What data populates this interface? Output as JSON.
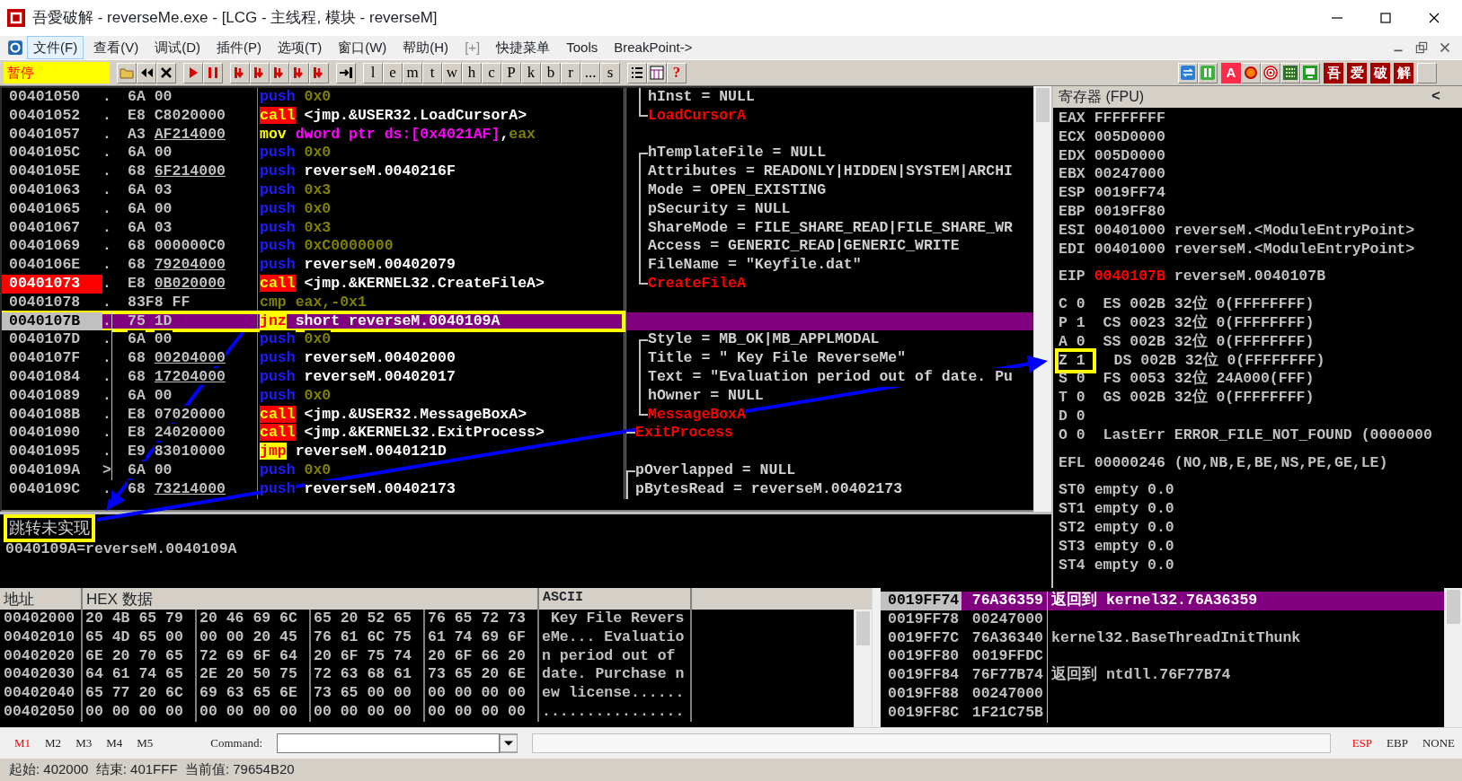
{
  "window": {
    "title": "吾愛破解 - reverseMe.exe - [LCG - 主线程, 模块 - reverseM]"
  },
  "menu": [
    {
      "label": "文件(F)",
      "selected": true,
      "disabled": false
    },
    {
      "label": "查看(V)",
      "selected": false,
      "disabled": false
    },
    {
      "label": "调试(D)",
      "selected": false,
      "disabled": false
    },
    {
      "label": "插件(P)",
      "selected": false,
      "disabled": false
    },
    {
      "label": "选项(T)",
      "selected": false,
      "disabled": false
    },
    {
      "label": "窗口(W)",
      "selected": false,
      "disabled": false
    },
    {
      "label": "帮助(H)",
      "selected": false,
      "disabled": false
    },
    {
      "label": "[+]",
      "selected": false,
      "disabled": true
    },
    {
      "label": "快捷菜单",
      "selected": false,
      "disabled": false
    },
    {
      "label": "Tools",
      "selected": false,
      "disabled": false
    },
    {
      "label": "BreakPoint->",
      "selected": false,
      "disabled": false
    }
  ],
  "toolbar": {
    "status": "暂停",
    "letters": [
      "l",
      "e",
      "m",
      "t",
      "w",
      "h",
      "c",
      "P",
      "k",
      "b",
      "r",
      "...",
      "s"
    ],
    "help": "?",
    "plugins": [
      "A",
      "吾",
      "爱",
      "破",
      "解"
    ]
  },
  "disassembly": {
    "rows": [
      {
        "address": "00401050",
        "mark": ".",
        "opcode": "6A",
        "arg": "00",
        "ref": false,
        "mnemonic": "push",
        "kind": "push",
        "operand": [
          {
            "text": "0x0",
            "kind": "const"
          }
        ],
        "breakpoint": false,
        "current": false,
        "boxed": false,
        "in_jump": false,
        "comment": {
          "text": "hInst = NULL",
          "kind": "arg",
          "bracket_start": false,
          "bracket_end": false,
          "outer": false
        }
      },
      {
        "address": "00401052",
        "mark": ".",
        "opcode": "E8",
        "arg": "C8020000",
        "ref": false,
        "mnemonic": "call",
        "kind": "call",
        "operand": [
          {
            "text": "<jmp.&USER32.LoadCursorA>",
            "kind": "plain"
          }
        ],
        "breakpoint": false,
        "current": false,
        "boxed": false,
        "in_jump": false,
        "comment": {
          "text": "LoadCursorA",
          "kind": "api",
          "bracket_start": false,
          "bracket_end": true,
          "outer": false
        }
      },
      {
        "address": "00401057",
        "mark": ".",
        "opcode": "A3",
        "arg": "AF214000",
        "ref": true,
        "mnemonic": "mov",
        "kind": "mov",
        "operand": [
          {
            "text": "dword ptr ds:[0x4021AF]",
            "kind": "mem"
          },
          {
            "text": ",",
            "kind": "plain"
          },
          {
            "text": "eax",
            "kind": "const"
          }
        ],
        "breakpoint": false,
        "current": false,
        "boxed": false,
        "in_jump": false
      },
      {
        "address": "0040105C",
        "mark": ".",
        "opcode": "6A",
        "arg": "00",
        "ref": false,
        "mnemonic": "push",
        "kind": "push",
        "operand": [
          {
            "text": "0x0",
            "kind": "const"
          }
        ],
        "breakpoint": false,
        "current": false,
        "boxed": false,
        "in_jump": false,
        "comment": {
          "text": "hTemplateFile = NULL",
          "kind": "arg",
          "bracket_start": true,
          "bracket_end": false,
          "outer": false
        }
      },
      {
        "address": "0040105E",
        "mark": ".",
        "opcode": "68",
        "arg": "6F214000",
        "ref": true,
        "mnemonic": "push",
        "kind": "push",
        "operand": [
          {
            "text": "reverseM.0040216F",
            "kind": "plain"
          }
        ],
        "breakpoint": false,
        "current": false,
        "boxed": false,
        "in_jump": false,
        "comment": {
          "text": "Attributes = READONLY|HIDDEN|SYSTEM|ARCHI",
          "kind": "arg",
          "bracket_start": false,
          "bracket_end": false,
          "outer": false
        }
      },
      {
        "address": "00401063",
        "mark": ".",
        "opcode": "6A",
        "arg": "03",
        "ref": false,
        "mnemonic": "push",
        "kind": "push",
        "operand": [
          {
            "text": "0x3",
            "kind": "const"
          }
        ],
        "breakpoint": false,
        "current": false,
        "boxed": false,
        "in_jump": false,
        "comment": {
          "text": "Mode = OPEN_EXISTING",
          "kind": "arg",
          "bracket_start": false,
          "bracket_end": false,
          "outer": false
        }
      },
      {
        "address": "00401065",
        "mark": ".",
        "opcode": "6A",
        "arg": "00",
        "ref": false,
        "mnemonic": "push",
        "kind": "push",
        "operand": [
          {
            "text": "0x0",
            "kind": "const"
          }
        ],
        "breakpoint": false,
        "current": false,
        "boxed": false,
        "in_jump": false,
        "comment": {
          "text": "pSecurity = NULL",
          "kind": "arg",
          "bracket_start": false,
          "bracket_end": false,
          "outer": false
        }
      },
      {
        "address": "00401067",
        "mark": ".",
        "opcode": "6A",
        "arg": "03",
        "ref": false,
        "mnemonic": "push",
        "kind": "push",
        "operand": [
          {
            "text": "0x3",
            "kind": "const"
          }
        ],
        "breakpoint": false,
        "current": false,
        "boxed": false,
        "in_jump": false,
        "comment": {
          "text": "ShareMode = FILE_SHARE_READ|FILE_SHARE_WR",
          "kind": "arg",
          "bracket_start": false,
          "bracket_end": false,
          "outer": false
        }
      },
      {
        "address": "00401069",
        "mark": ".",
        "opcode": "68",
        "arg": "000000C0",
        "ref": false,
        "mnemonic": "push",
        "kind": "push",
        "operand": [
          {
            "text": "0xC0000000",
            "kind": "const"
          }
        ],
        "breakpoint": false,
        "current": false,
        "boxed": false,
        "in_jump": false,
        "comment": {
          "text": "Access = GENERIC_READ|GENERIC_WRITE",
          "kind": "arg",
          "bracket_start": false,
          "bracket_end": false,
          "outer": false
        }
      },
      {
        "address": "0040106E",
        "mark": ".",
        "opcode": "68",
        "arg": "79204000",
        "ref": true,
        "mnemonic": "push",
        "kind": "push",
        "operand": [
          {
            "text": "reverseM.00402079",
            "kind": "plain"
          }
        ],
        "breakpoint": false,
        "current": false,
        "boxed": false,
        "in_jump": false,
        "comment": {
          "text": "FileName = \"Keyfile.dat\"",
          "kind": "arg",
          "bracket_start": false,
          "bracket_end": false,
          "outer": false
        }
      },
      {
        "address": "00401073",
        "mark": ".",
        "opcode": "E8",
        "arg": "0B020000",
        "ref": true,
        "mnemonic": "call",
        "kind": "call",
        "operand": [
          {
            "text": "<jmp.&KERNEL32.CreateFileA>",
            "kind": "plain"
          }
        ],
        "breakpoint": true,
        "current": false,
        "boxed": false,
        "in_jump": false,
        "comment": {
          "text": "CreateFileA",
          "kind": "api",
          "bracket_start": false,
          "bracket_end": true,
          "outer": false
        }
      },
      {
        "address": "00401078",
        "mark": ".",
        "opcode": "83F8",
        "arg": "FF",
        "ref": false,
        "mnemonic": "cmp",
        "kind": "cmp",
        "operand": [
          {
            "text": "eax,-0x1",
            "kind": "const"
          }
        ],
        "breakpoint": false,
        "current": false,
        "boxed": false,
        "in_jump": false
      },
      {
        "address": "0040107B",
        "mark": ".",
        "opcode": "75",
        "arg": "1D",
        "ref": false,
        "mnemonic": "jnz",
        "kind": "jcc",
        "operand": [
          {
            "text": "short reverseM.0040109A",
            "kind": "plain"
          }
        ],
        "breakpoint": false,
        "current": true,
        "boxed": true,
        "in_jump": true
      },
      {
        "address": "0040107D",
        "mark": ".",
        "opcode": "6A",
        "arg": "00",
        "ref": false,
        "mnemonic": "push",
        "kind": "push",
        "operand": [
          {
            "text": "0x0",
            "kind": "const"
          }
        ],
        "breakpoint": false,
        "current": false,
        "boxed": false,
        "in_jump": true,
        "comment": {
          "text": "Style = MB_OK|MB_APPLMODAL",
          "kind": "arg",
          "bracket_start": true,
          "bracket_end": false,
          "outer": false
        }
      },
      {
        "address": "0040107F",
        "mark": ".",
        "opcode": "68",
        "arg": "00204000",
        "ref": true,
        "mnemonic": "push",
        "kind": "push",
        "operand": [
          {
            "text": "reverseM.00402000",
            "kind": "plain"
          }
        ],
        "breakpoint": false,
        "current": false,
        "boxed": false,
        "in_jump": true,
        "comment": {
          "text": "Title = \" Key File ReverseMe\"",
          "kind": "arg",
          "bracket_start": false,
          "bracket_end": false,
          "outer": false
        }
      },
      {
        "address": "00401084",
        "mark": ".",
        "opcode": "68",
        "arg": "17204000",
        "ref": true,
        "mnemonic": "push",
        "kind": "push",
        "operand": [
          {
            "text": "reverseM.00402017",
            "kind": "plain"
          }
        ],
        "breakpoint": false,
        "current": false,
        "boxed": false,
        "in_jump": true,
        "comment": {
          "text": "Text = \"Evaluation period out of date. Pu",
          "kind": "arg",
          "bracket_start": false,
          "bracket_end": false,
          "outer": false
        }
      },
      {
        "address": "00401089",
        "mark": ".",
        "opcode": "6A",
        "arg": "00",
        "ref": false,
        "mnemonic": "push",
        "kind": "push",
        "operand": [
          {
            "text": "0x0",
            "kind": "const"
          }
        ],
        "breakpoint": false,
        "current": false,
        "boxed": false,
        "in_jump": true,
        "comment": {
          "text": "hOwner = NULL",
          "kind": "arg",
          "bracket_start": false,
          "bracket_end": false,
          "outer": false
        }
      },
      {
        "address": "0040108B",
        "mark": ".",
        "opcode": "E8",
        "arg": "07020000",
        "ref": false,
        "mnemonic": "call",
        "kind": "call",
        "operand": [
          {
            "text": "<jmp.&USER32.MessageBoxA>",
            "kind": "plain"
          }
        ],
        "breakpoint": false,
        "current": false,
        "boxed": false,
        "in_jump": true,
        "comment": {
          "text": "MessageBoxA",
          "kind": "api",
          "bracket_start": false,
          "bracket_end": true,
          "outer": false
        }
      },
      {
        "address": "00401090",
        "mark": ".",
        "opcode": "E8",
        "arg": "24020000",
        "ref": false,
        "mnemonic": "call",
        "kind": "call",
        "operand": [
          {
            "text": "<jmp.&KERNEL32.ExitProcess>",
            "kind": "plain"
          }
        ],
        "breakpoint": false,
        "current": false,
        "boxed": false,
        "in_jump": true,
        "comment": {
          "text": "ExitProcess",
          "kind": "api",
          "bracket_start": true,
          "bracket_end": true,
          "outer": true
        }
      },
      {
        "address": "00401095",
        "mark": ".",
        "opcode": "E9",
        "arg": "83010000",
        "ref": false,
        "mnemonic": "jmp",
        "kind": "jmp",
        "operand": [
          {
            "text": "reverseM.0040121D",
            "kind": "plain"
          }
        ],
        "breakpoint": false,
        "current": false,
        "boxed": false,
        "in_jump": true
      },
      {
        "address": "0040109A",
        "mark": ">",
        "opcode": "6A",
        "arg": "00",
        "ref": false,
        "mnemonic": "push",
        "kind": "push",
        "operand": [
          {
            "text": "0x0",
            "kind": "const"
          }
        ],
        "breakpoint": false,
        "current": false,
        "boxed": false,
        "in_jump": true,
        "comment": {
          "text": "pOverlapped = NULL",
          "kind": "arg",
          "bracket_start": true,
          "bracket_end": false,
          "outer": true
        }
      },
      {
        "address": "0040109C",
        "mark": ".",
        "opcode": "68",
        "arg": "73214000",
        "ref": true,
        "mnemonic": "push",
        "kind": "push",
        "operand": [
          {
            "text": "reverseM.00402173",
            "kind": "plain"
          }
        ],
        "breakpoint": false,
        "current": false,
        "boxed": false,
        "in_jump": false,
        "comment": {
          "text": "pBytesRead = reverseM.00402173",
          "kind": "arg",
          "bracket_start": false,
          "bracket_end": false,
          "outer": true
        }
      }
    ]
  },
  "info": {
    "note": "跳转未实现",
    "boxed": true,
    "line": "0040109A=reverseM.0040109A"
  },
  "registers": {
    "title": "寄存器 (FPU)",
    "toggle": "<",
    "groups": [
      {
        "kind": "regs",
        "rows": [
          {
            "name": "EAX",
            "value": "FFFFFFFF",
            "changed": false
          },
          {
            "name": "ECX",
            "value": "005D0000",
            "changed": false
          },
          {
            "name": "EDX",
            "value": "005D0000",
            "changed": false
          },
          {
            "name": "EBX",
            "value": "00247000",
            "changed": false
          },
          {
            "name": "ESP",
            "value": "0019FF74",
            "changed": false
          },
          {
            "name": "EBP",
            "value": "0019FF80",
            "changed": false
          },
          {
            "name": "ESI",
            "value": "00401000",
            "note": "reverseM.<ModuleEntryPoint>",
            "changed": false
          },
          {
            "name": "EDI",
            "value": "00401000",
            "note": "reverseM.<ModuleEntryPoint>",
            "changed": false
          }
        ]
      },
      {
        "kind": "regs",
        "rows": [
          {
            "name": "EIP",
            "value": "0040107B",
            "note": "reverseM.0040107B",
            "changed": true
          }
        ]
      },
      {
        "kind": "flags",
        "rows": [
          {
            "flag": "C 0",
            "segment": "ES 002B 32位 0(FFFFFFFF)",
            "boxed": false
          },
          {
            "flag": "P 1",
            "segment": "CS 0023 32位 0(FFFFFFFF)",
            "boxed": false
          },
          {
            "flag": "A 0",
            "segment": "SS 002B 32位 0(FFFFFFFF)",
            "boxed": false
          },
          {
            "flag": "Z 1",
            "segment": "DS 002B 32位 0(FFFFFFFF)",
            "boxed": true
          },
          {
            "flag": "S 0",
            "segment": "FS 0053 32位 24A000(FFF)",
            "boxed": false
          },
          {
            "flag": "T 0",
            "segment": "GS 002B 32位 0(FFFFFFFF)",
            "boxed": false
          },
          {
            "flag": "D 0",
            "boxed": false
          },
          {
            "flag": "O 0",
            "segment": "LastErr ERROR_FILE_NOT_FOUND (0000000",
            "boxed": false
          }
        ]
      },
      {
        "kind": "regs",
        "rows": [
          {
            "name": "EFL",
            "value": "00000246",
            "note": "(NO,NB,E,BE,NS,PE,GE,LE)",
            "changed": false
          }
        ]
      },
      {
        "kind": "regs",
        "rows": [
          {
            "name": "ST0",
            "value": "empty",
            "note": "0.0",
            "changed": false
          },
          {
            "name": "ST1",
            "value": "empty",
            "note": "0.0",
            "changed": false
          },
          {
            "name": "ST2",
            "value": "empty",
            "note": "0.0",
            "changed": false
          },
          {
            "name": "ST3",
            "value": "empty",
            "note": "0.0",
            "changed": false
          },
          {
            "name": "ST4",
            "value": "empty",
            "note": "0.0",
            "changed": false
          }
        ]
      }
    ]
  },
  "dump": {
    "columns": [
      "地址",
      "HEX 数据",
      "ASCII"
    ],
    "rows": [
      {
        "address": "00402000",
        "bytes": [
          "20 4B 65 79",
          "20 46 69 6C",
          "65 20 52 65",
          "76 65 72 73"
        ],
        "ascii": " Key File Revers"
      },
      {
        "address": "00402010",
        "bytes": [
          "65 4D 65 00",
          "00 00 20 45",
          "76 61 6C 75",
          "61 74 69 6F"
        ],
        "ascii": "eMe... Evaluatio"
      },
      {
        "address": "00402020",
        "bytes": [
          "6E 20 70 65",
          "72 69 6F 64",
          "20 6F 75 74",
          "20 6F 66 20"
        ],
        "ascii": "n period out of "
      },
      {
        "address": "00402030",
        "bytes": [
          "64 61 74 65",
          "2E 20 50 75",
          "72 63 68 61",
          "73 65 20 6E"
        ],
        "ascii": "date. Purchase n"
      },
      {
        "address": "00402040",
        "bytes": [
          "65 77 20 6C",
          "69 63 65 6E",
          "73 65 00 00",
          "00 00 00 00"
        ],
        "ascii": "ew license......"
      },
      {
        "address": "00402050",
        "bytes": [
          "00 00 00 00",
          "00 00 00 00",
          "00 00 00 00",
          "00 00 00 00"
        ],
        "ascii": "................"
      }
    ]
  },
  "stack": {
    "rows": [
      {
        "address": "0019FF74",
        "value": "76A36359",
        "comment": "返回到 kernel32.76A36359",
        "selected": true
      },
      {
        "address": "0019FF78",
        "value": "00247000",
        "selected": false
      },
      {
        "address": "0019FF7C",
        "value": "76A36340",
        "comment": "kernel32.BaseThreadInitThunk",
        "selected": false
      },
      {
        "address": "0019FF80",
        "value": "0019FFDC",
        "selected": false
      },
      {
        "address": "0019FF84",
        "value": "76F77B74",
        "comment": "返回到 ntdll.76F77B74",
        "selected": false
      },
      {
        "address": "0019FF88",
        "value": "00247000",
        "selected": false
      },
      {
        "address": "0019FF8C",
        "value": "1F21C75B",
        "selected": false
      }
    ]
  },
  "bottom_bar": {
    "memory_tabs": [
      {
        "label": "M1",
        "selected": true
      },
      {
        "label": "M2",
        "selected": false
      },
      {
        "label": "M3",
        "selected": false
      },
      {
        "label": "M4",
        "selected": false
      },
      {
        "label": "M5",
        "selected": false
      }
    ],
    "command_label": "Command:",
    "stack_modes": [
      {
        "label": "ESP",
        "selected": true
      },
      {
        "label": "EBP",
        "selected": false
      },
      {
        "label": "NONE",
        "selected": false
      }
    ]
  },
  "status_bar": "起始: 402000  结束: 401FFF  当前值: 79654B20"
}
